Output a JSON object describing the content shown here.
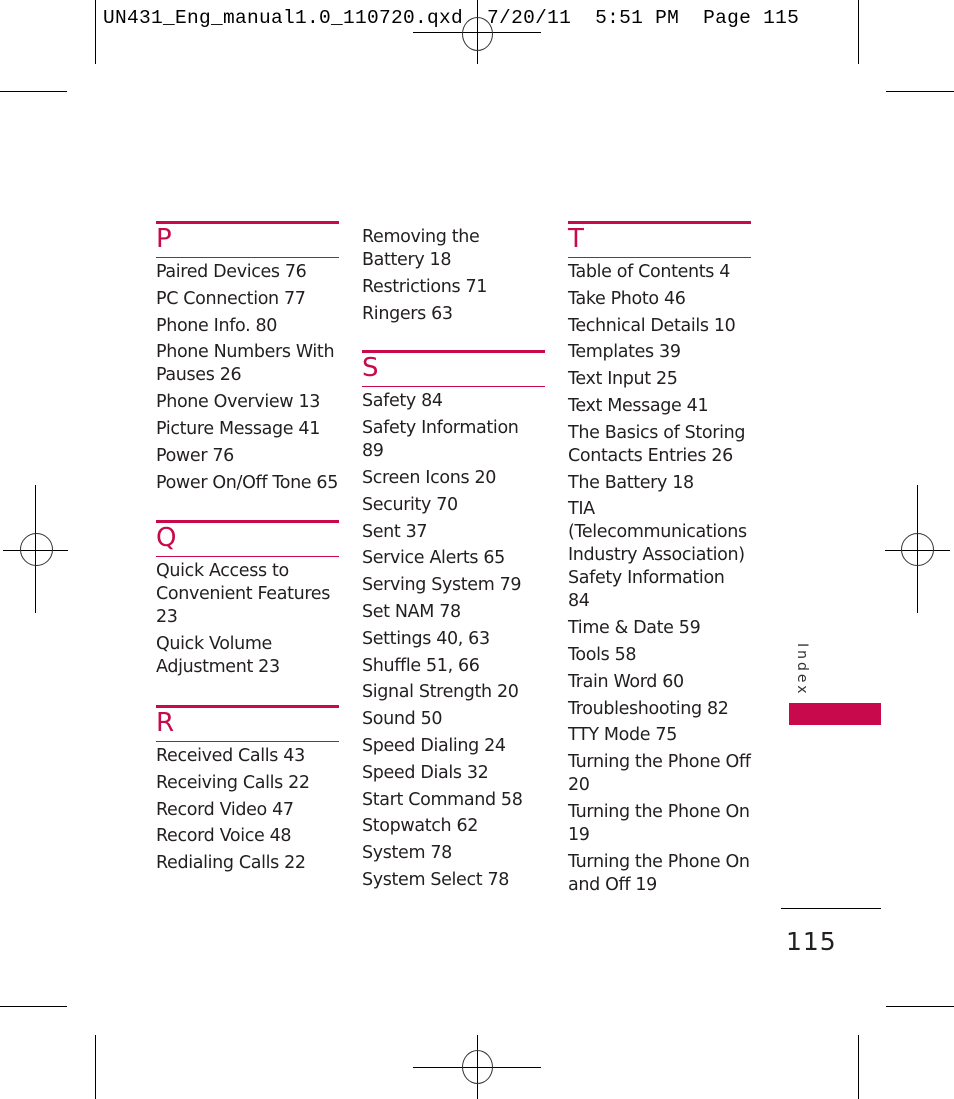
{
  "slug_line": "UN431_Eng_manual1.0_110720.qxd  7/20/11  5:51 PM  Page 115",
  "side_tab": {
    "label": "Index",
    "color": "#c8094b"
  },
  "folio": "115",
  "accent_color": "#c8094b",
  "columns": [
    {
      "sections": [
        {
          "letter": "P",
          "entries": [
            "Paired Devices 76",
            "PC Connection 77",
            "Phone Info. 80",
            "Phone Numbers With Pauses 26",
            "Phone Overview 13",
            "Picture Message 41",
            "Power 76",
            "Power On/Off Tone 65"
          ]
        },
        {
          "letter": "Q",
          "entries": [
            "Quick Access to Convenient Features 23",
            "Quick Volume Adjustment 23"
          ]
        },
        {
          "letter": "R",
          "entries": [
            "Received Calls 43",
            "Receiving Calls 22",
            "Record Video 47",
            "Record Voice 48",
            "Redialing Calls 22"
          ]
        }
      ]
    },
    {
      "continued_entries": [
        "Removing the Battery 18",
        "Restrictions 71",
        "Ringers 63"
      ],
      "sections": [
        {
          "letter": "S",
          "entries": [
            "Safety 84",
            "Safety Information 89",
            "Screen Icons 20",
            "Security 70",
            "Sent 37",
            "Service Alerts 65",
            "Serving System 79",
            "Set NAM 78",
            "Settings 40, 63",
            "Shuffle 51, 66",
            "Signal Strength 20",
            "Sound 50",
            "Speed Dialing 24",
            "Speed Dials 32",
            "Start Command 58",
            "Stopwatch 62",
            "System 78",
            "System Select 78"
          ]
        }
      ]
    },
    {
      "sections": [
        {
          "letter": "T",
          "entries": [
            "Table of Contents 4",
            "Take Photo 46",
            "Technical Details 10",
            "Templates 39",
            "Text Input 25",
            "Text Message 41",
            "The Basics of Storing Contacts Entries 26",
            "The Battery 18",
            "TIA (Telecommunications Industry Association) Safety Information 84",
            "Time & Date 59",
            "Tools 58",
            "Train Word 60",
            "Troubleshooting 82",
            "TTY Mode 75",
            "Turning the Phone Off 20",
            "Turning the Phone On 19",
            "Turning the Phone On and Off 19"
          ]
        }
      ]
    }
  ]
}
